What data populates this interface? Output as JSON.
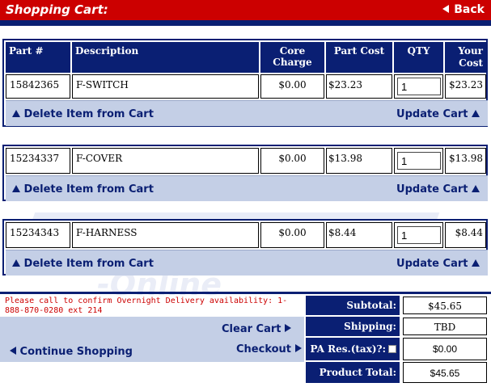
{
  "header": {
    "title": "Shopping Cart:",
    "back_label": "Back"
  },
  "table": {
    "columns": [
      "Part #",
      "Description",
      "Core Charge",
      "Part Cost",
      "QTY",
      "Your Cost"
    ]
  },
  "items": [
    {
      "part": "15842365",
      "description": "F-SWITCH",
      "core": "$0.00",
      "cost": "$23.23",
      "qty": "1",
      "your_cost": "$23.23"
    },
    {
      "part": "15234337",
      "description": "F-COVER",
      "core": "$0.00",
      "cost": "$13.98",
      "qty": "1",
      "your_cost": "$13.98"
    },
    {
      "part": "15234343",
      "description": "F-HARNESS",
      "core": "$0.00",
      "cost": "$8.44",
      "qty": "1",
      "your_cost": "$8.44"
    }
  ],
  "actions": {
    "delete_label": "Delete Item from Cart",
    "update_label": "Update Cart"
  },
  "notice": "Please call to confirm Overnight Delivery availability: 1-888-870-0280 ext 214",
  "bottom": {
    "clear_label": "Clear Cart",
    "checkout_label": "Checkout",
    "continue_label": "Continue Shopping"
  },
  "totals": {
    "subtotal_label": "Subtotal:",
    "subtotal": "$45.65",
    "shipping_label": "Shipping:",
    "shipping": "TBD",
    "tax_label": "PA Res.(tax)?:",
    "tax": "$0.00",
    "total_label": "Product Total:",
    "total": "$45.65"
  },
  "watermark": "-Online",
  "colors": {
    "header_red": "#cc0000",
    "navy": "#0a1f73",
    "panel_blue": "#c4cfe6"
  }
}
